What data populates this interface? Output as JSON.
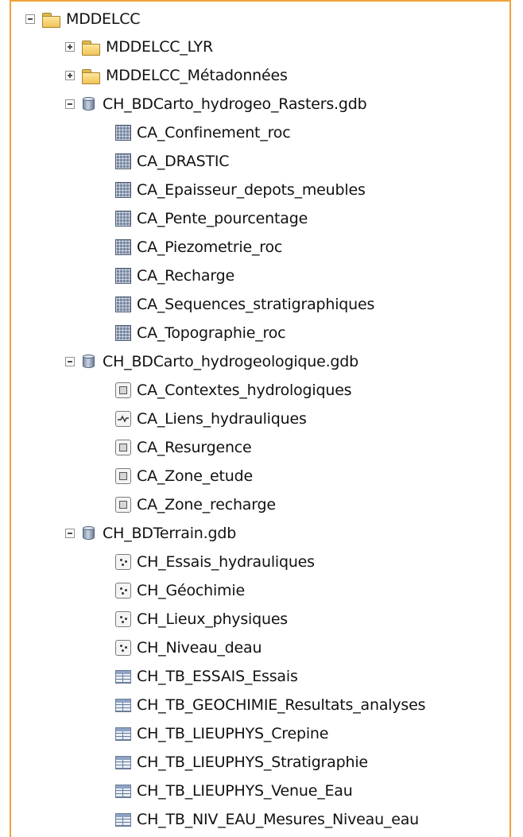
{
  "tree": {
    "root": {
      "label": "MDDELCC",
      "expanded": true,
      "icon": "folder-icon"
    },
    "folders": [
      {
        "label": "MDDELCC_LYR",
        "expanded": false,
        "icon": "folder-icon"
      },
      {
        "label": "MDDELCC_Métadonnées",
        "expanded": false,
        "icon": "folder-icon"
      }
    ],
    "gdb1": {
      "label": "CH_BDCarto_hydrogeo_Rasters.gdb",
      "icon": "geodatabase-icon",
      "items": [
        {
          "label": "CA_Confinement_roc",
          "icon": "raster-icon"
        },
        {
          "label": "CA_DRASTIC",
          "icon": "raster-icon"
        },
        {
          "label": "CA_Epaisseur_depots_meubles",
          "icon": "raster-icon"
        },
        {
          "label": "CA_Pente_pourcentage",
          "icon": "raster-icon"
        },
        {
          "label": "CA_Piezometrie_roc",
          "icon": "raster-icon"
        },
        {
          "label": "CA_Recharge",
          "icon": "raster-icon"
        },
        {
          "label": "CA_Sequences_stratigraphiques",
          "icon": "raster-icon"
        },
        {
          "label": "CA_Topographie_roc",
          "icon": "raster-icon"
        }
      ]
    },
    "gdb2": {
      "label": "CH_BDCarto_hydrogeologique.gdb",
      "icon": "geodatabase-icon",
      "items": [
        {
          "label": "CA_Contextes_hydrologiques",
          "icon": "polygon-feature-icon"
        },
        {
          "label": "CA_Liens_hydrauliques",
          "icon": "line-feature-icon"
        },
        {
          "label": "CA_Resurgence",
          "icon": "polygon-feature-icon"
        },
        {
          "label": "CA_Zone_etude",
          "icon": "polygon-feature-icon"
        },
        {
          "label": "CA_Zone_recharge",
          "icon": "polygon-feature-icon"
        }
      ]
    },
    "gdb3": {
      "label": "CH_BDTerrain.gdb",
      "icon": "geodatabase-icon",
      "items": [
        {
          "label": "CH_Essais_hydrauliques",
          "icon": "point-feature-icon"
        },
        {
          "label": "CH_Géochimie",
          "icon": "point-feature-icon"
        },
        {
          "label": "CH_Lieux_physiques",
          "icon": "point-feature-icon"
        },
        {
          "label": "CH_Niveau_deau",
          "icon": "point-feature-icon"
        },
        {
          "label": "CH_TB_ESSAIS_Essais",
          "icon": "table-icon"
        },
        {
          "label": "CH_TB_GEOCHIMIE_Resultats_analyses",
          "icon": "table-icon"
        },
        {
          "label": "CH_TB_LIEUPHYS_Crepine",
          "icon": "table-icon"
        },
        {
          "label": "CH_TB_LIEUPHYS_Stratigraphie",
          "icon": "table-icon"
        },
        {
          "label": "CH_TB_LIEUPHYS_Venue_Eau",
          "icon": "table-icon"
        },
        {
          "label": "CH_TB_NIV_EAU_Mesures_Niveau_eau",
          "icon": "table-icon"
        }
      ]
    }
  },
  "colors": {
    "frame_border": "#f0a23c"
  }
}
